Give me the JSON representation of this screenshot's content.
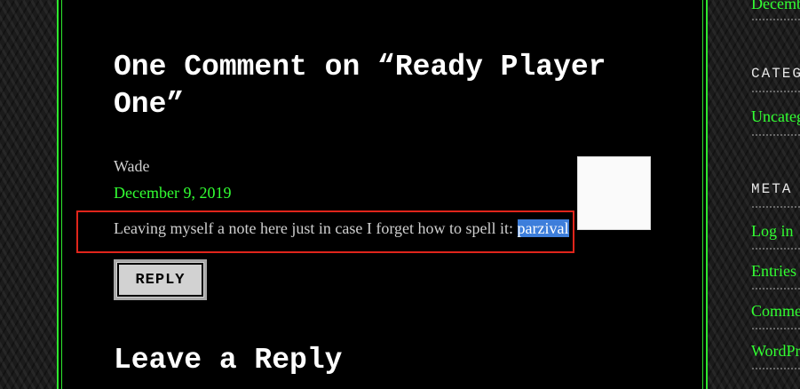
{
  "comments": {
    "title": "One Comment on “Ready Player One”",
    "comment": {
      "author": "Wade",
      "date": "December 9, 2019",
      "text_before": "Leaving myself a note here just in case I forget how to spell it: ",
      "selected_text": "parzival",
      "reply_label": "REPLY"
    }
  },
  "reply_section": {
    "title": "Leave a Reply"
  },
  "sidebar": {
    "archive_item": "Decemb",
    "categories_heading": "CATEG",
    "category_item": "Uncateg",
    "meta_heading": "META",
    "meta_items": [
      "Log in",
      "Entries",
      "Comme",
      "WordPr"
    ]
  },
  "colors": {
    "link": "#32ff32",
    "border": "#2ee82e",
    "highlight_box": "#e0251b",
    "selection": "#3d7edb"
  }
}
